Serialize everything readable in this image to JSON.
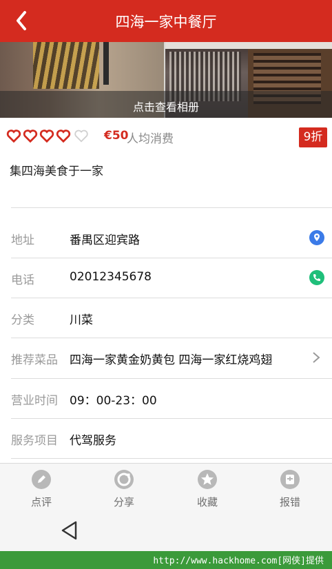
{
  "header": {
    "title": "四海一家中餐厅",
    "back_icon": "back-arrow-icon"
  },
  "gallery": {
    "caption": "点击查看相册"
  },
  "rating": {
    "score": 4,
    "max": 5,
    "price": "€50",
    "price_label": "人均消费",
    "discount": "9折"
  },
  "tagline": "集四海美食于一家",
  "details": [
    {
      "label": "地址",
      "value": "番禺区迎宾路",
      "icon": "location-pin-icon"
    },
    {
      "label": "电话",
      "value": "02012345678",
      "icon": "phone-icon"
    },
    {
      "label": "分类",
      "value": "川菜"
    },
    {
      "label": "推荐菜品",
      "value": "四海一家黄金奶黄包 四海一家红烧鸡翅",
      "icon": "chevron-right-icon"
    },
    {
      "label": "营业时间",
      "value": "09：00-23：00"
    },
    {
      "label": "服务项目",
      "value": "代驾服务"
    }
  ],
  "bottom_bar": [
    {
      "label": "点评",
      "icon": "pencil-icon"
    },
    {
      "label": "分享",
      "icon": "share-icon"
    },
    {
      "label": "收藏",
      "icon": "star-icon"
    },
    {
      "label": "报错",
      "icon": "report-icon"
    }
  ],
  "watermark": "http://www.hackhome.com[网侠]提供",
  "colors": {
    "brand_red": "#d42b1f",
    "location_blue": "#3b7be8",
    "phone_green": "#1fbf7a",
    "watermark_green": "#3b9a3a"
  }
}
